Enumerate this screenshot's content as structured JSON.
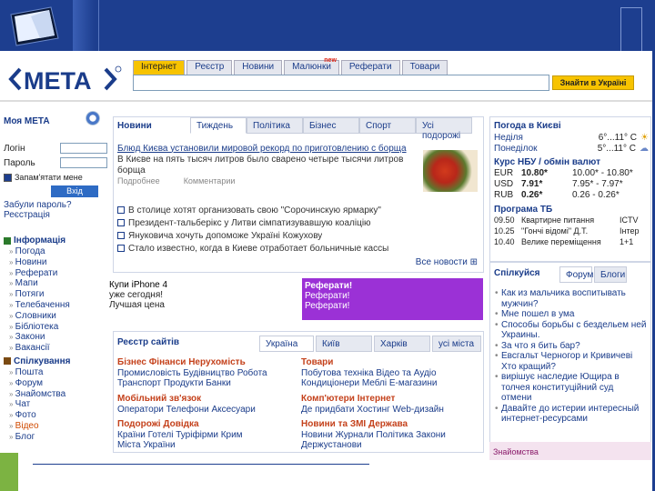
{
  "logo": {
    "text": "META"
  },
  "search": {
    "tabs": [
      "Інтернет",
      "Реєстр",
      "Новини",
      "Малюнки",
      "Реферати",
      "Товари"
    ],
    "active_tab": 0,
    "new_badge": "new",
    "input_value": "",
    "button_label": "Знайти в Україні"
  },
  "sidebar": {
    "title": "Моя МЕТА",
    "login_label": "Логін",
    "password_label": "Пароль",
    "remember_label": "Запам'ятати мене",
    "submit_label": "Вхід",
    "forgot_label": "Забули пароль?",
    "register_label": "Реєстрація",
    "info_title": "Інформація",
    "info_items": [
      "Погода",
      "Новини",
      "Реферати",
      "Мапи",
      "Потяги",
      "Телебачення",
      "Словники",
      "Бібліотека",
      "Закони",
      "Вакансії"
    ],
    "community_title": "Спілкування",
    "community_items": [
      "Пошта",
      "Форум",
      "Знайомства",
      "Чат",
      "Фото",
      "Відео",
      "Блог"
    ]
  },
  "news": {
    "title": "Новини",
    "tabs": [
      "Тиждень",
      "Політика",
      "Бізнес",
      "Спорт",
      "Усі подорожі"
    ],
    "headline": "Блюд Києва установили мировой рекорд по приготовлению с борща",
    "summary_line1": "В Києве на пять тысяч литров было сварено четыре тысячи литров",
    "summary_line2": "борща",
    "meta_left": "Подробнее",
    "meta_right": "Комментарии",
    "items": [
      "В столице хотят организовать свою \"Сорочинскую ярмарку\"",
      "Президент-тальберікс у Литви сімпатизувавшую коаліцію",
      "Януковича хочуть допоможе Україні Кожухову",
      "Стало известно, когда в Киеве отработает больничные кассы"
    ],
    "all_link": "Все новости"
  },
  "promo": {
    "left_lines": [
      "Купи iPhone 4",
      "уже сегодня!",
      "Лучшая цена"
    ],
    "right_lines": [
      "Реферати!",
      "Реферати!",
      "Реферати!"
    ]
  },
  "registry": {
    "title": "Реєстр сайтів",
    "tabs": [
      "Україна",
      "Київ",
      "Харків",
      "усі міста"
    ],
    "col1": [
      {
        "title": "Бізнес",
        "title2": "Фінанси",
        "title3": "Нерухомість",
        "items": "Промисловість  Будівництво  Робота",
        "items2": "Транспорт  Продукти  Банки"
      },
      {
        "title": "Мобільний зв'язок",
        "items": "Оператори  Телефони  Аксесуари"
      },
      {
        "title": "Подорожі",
        "title2": "Довідка",
        "items": "Країни  Готелі  Туріфірми  Крим",
        "items2": "Міста України"
      }
    ],
    "col2": [
      {
        "title": "Товари",
        "items": "Побутова техніка  Відео та Аудіо",
        "items2": "Кондиціонери  Меблі  Е-магазини"
      },
      {
        "title": "Комп'ютери",
        "title2": "Інтернет",
        "items": "Де придбати  Хостинг  Web-дизайн"
      },
      {
        "title": "Новини та ЗМІ",
        "title2": "Держава",
        "items": "Новини  Журнали  Політика  Закони",
        "items2": "Держустанови"
      }
    ]
  },
  "weather": {
    "title": "Погода в Києві",
    "rows": [
      {
        "day": "Неділя",
        "temp": "6°...11° С"
      },
      {
        "day": "Понеділок",
        "temp": "5°...11° С"
      }
    ]
  },
  "currency": {
    "title": "Курс НБУ / обмін валют",
    "rows": [
      {
        "code": "EUR",
        "rate": "10.80*",
        "range": "10.00* - 10.80*"
      },
      {
        "code": "USD",
        "rate": "7.91*",
        "range": "7.95* - 7.97*"
      },
      {
        "code": "RUB",
        "rate": "0.26*",
        "range": "0.26 - 0.26*"
      }
    ]
  },
  "tv": {
    "title": "Програма ТБ",
    "rows": [
      {
        "time": "09.50",
        "show": "Квартирне питання",
        "channel": "ICTV"
      },
      {
        "time": "10.25",
        "show": "\"Гончі відомі\" Д.Т.",
        "channel": "Інтер"
      },
      {
        "time": "10.40",
        "show": "Велике переміщення",
        "channel": "1+1"
      }
    ]
  },
  "forum": {
    "title": "Спілкуйся",
    "tabs": [
      "Форум",
      "Блоги"
    ],
    "items": [
      "Как из мальчика воспитывать мужчин?",
      "Мне пошел в ума",
      "Способы борьбы с бездельем ней",
      "Украины.",
      "За что я бить бар?",
      "Евсгальт Черногор и Кривичеві Хто кращий?",
      "вирішує наследие Ющира в толчея конституційний суд",
      "отмени",
      "Давайте до истерии интересный интернет-ресурсами"
    ]
  },
  "ad": {
    "text": "Знайомства"
  }
}
